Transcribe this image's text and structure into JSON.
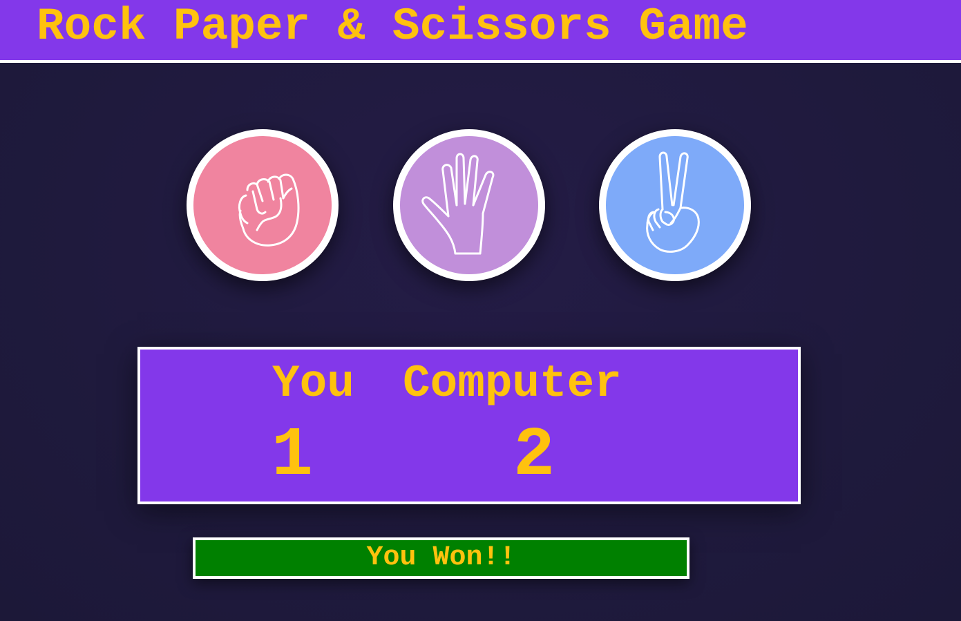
{
  "header": {
    "title": "Rock Paper & Scissors Game"
  },
  "choices": [
    {
      "id": "rock",
      "icon": "rock-fist-icon",
      "color": "#f0849f"
    },
    {
      "id": "paper",
      "icon": "paper-hand-icon",
      "color": "#c18fda"
    },
    {
      "id": "scissors",
      "icon": "scissors-peace-icon",
      "color": "#7eaaf9"
    }
  ],
  "scoreboard": {
    "you_label": "You",
    "computer_label": "Computer",
    "you_score": "1",
    "computer_score": "2"
  },
  "result": {
    "message": "You Won!!",
    "color": "#008000"
  },
  "colors": {
    "accent": "#8338ea",
    "text": "#ffc20e",
    "background": "#1f1a3d"
  }
}
